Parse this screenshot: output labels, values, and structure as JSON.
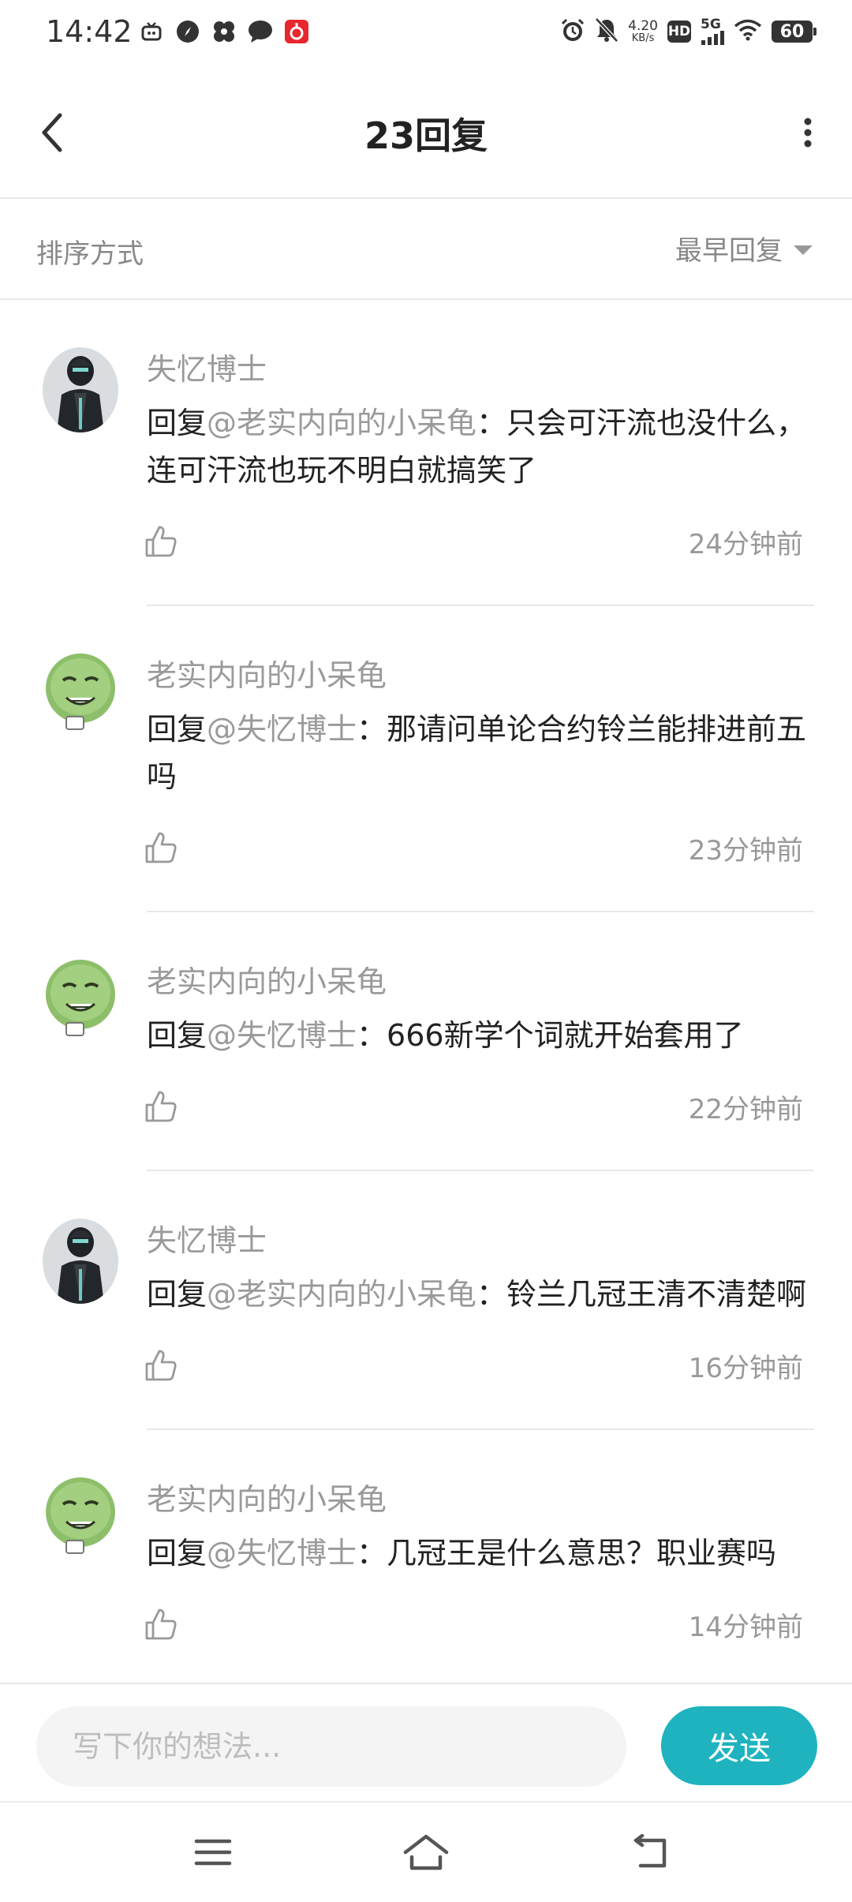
{
  "status_bar": {
    "time": "14:42",
    "net_speed_value": "4.20",
    "net_speed_unit": "KB/s",
    "hd": "HD",
    "signal": "5G",
    "battery": "60",
    "left_icons": [
      "tv-icon",
      "compass-icon",
      "pinwheel-icon",
      "chat-bubble-icon",
      "music-app-icon"
    ],
    "right_icons": [
      "alarm-icon",
      "mute-bell-icon",
      "wifi-icon"
    ]
  },
  "header": {
    "title": "23回复",
    "back_icon": "chevron-left-icon",
    "more_icon": "more-vertical-icon"
  },
  "sort": {
    "label": "排序方式",
    "selected": "最早回复"
  },
  "replies": [
    {
      "user": "失忆博士",
      "avatar": "dark-figure",
      "prefix": "回复",
      "mention": "@老实内向的小呆龟",
      "sep": "：",
      "body": "只会可汗流也没什么，连可汗流也玩不明白就搞笑了",
      "time": "24分钟前"
    },
    {
      "user": "老实内向的小呆龟",
      "avatar": "green-meme",
      "prefix": "回复",
      "mention": "@失忆博士",
      "sep": "：",
      "body": "那请问单论合约铃兰能排进前五吗",
      "time": "23分钟前"
    },
    {
      "user": "老实内向的小呆龟",
      "avatar": "green-meme",
      "prefix": "回复",
      "mention": "@失忆博士",
      "sep": "：",
      "body": "666新学个词就开始套用了",
      "time": "22分钟前"
    },
    {
      "user": "失忆博士",
      "avatar": "dark-figure",
      "prefix": "回复",
      "mention": "@老实内向的小呆龟",
      "sep": "：",
      "body": "铃兰几冠王清不清楚啊",
      "time": "16分钟前"
    },
    {
      "user": "老实内向的小呆龟",
      "avatar": "green-meme",
      "prefix": "回复",
      "mention": "@失忆博士",
      "sep": "：",
      "body": "几冠王是什么意思？职业赛吗",
      "time": "14分钟前"
    }
  ],
  "compose": {
    "placeholder": "写下你的想法...",
    "send_label": "发送"
  },
  "colors": {
    "accent": "#1eb3bf",
    "muted_text": "#9a9a9a",
    "divider": "#e8e8e8"
  },
  "nav": [
    "menu-icon",
    "home-icon",
    "back-arrow-icon"
  ]
}
